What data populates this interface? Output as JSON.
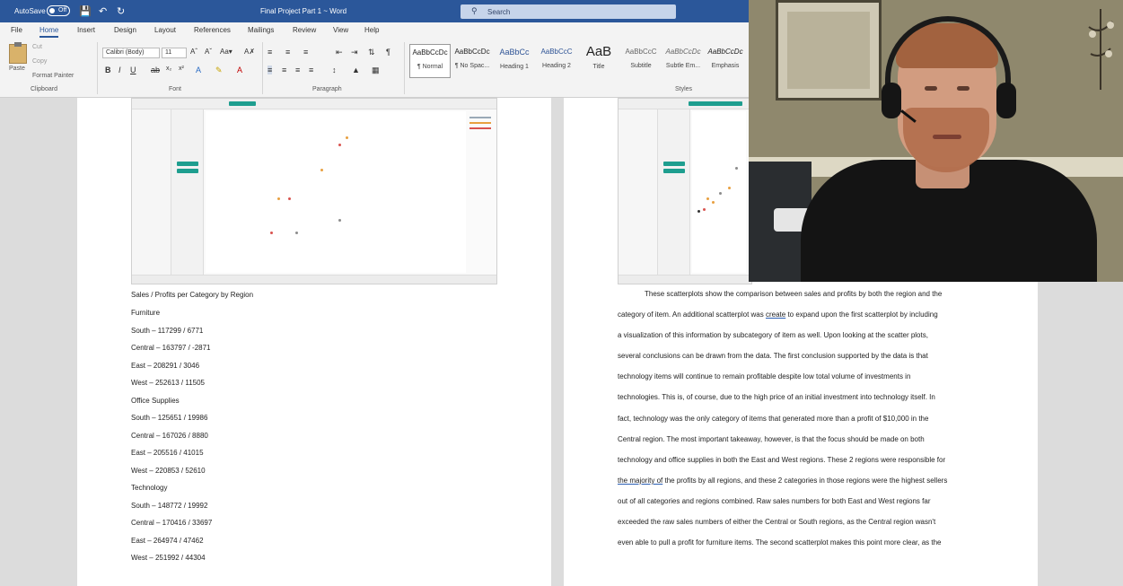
{
  "titlebar": {
    "autosave_label": "AutoSave",
    "autosave_state": "Off",
    "document_title": "Final Project Part 1 ~ Word",
    "search_placeholder": "Search"
  },
  "tabs": [
    "File",
    "Home",
    "Insert",
    "Design",
    "Layout",
    "References",
    "Mailings",
    "Review",
    "View",
    "Help"
  ],
  "active_tab": "Home",
  "ribbon": {
    "clipboard": {
      "paste": "Paste",
      "cut": "Cut",
      "copy": "Copy",
      "format_painter": "Format Painter",
      "label": "Clipboard"
    },
    "font": {
      "family": "Calibri (Body)",
      "size": "11",
      "label": "Font"
    },
    "paragraph_label": "Paragraph",
    "styles_label": "Styles",
    "styles": [
      {
        "sample": "AaBbCcDc",
        "name": "¶ Normal"
      },
      {
        "sample": "AaBbCcDc",
        "name": "¶ No Spac..."
      },
      {
        "sample": "AaBbCc",
        "name": "Heading 1"
      },
      {
        "sample": "AaBbCcC",
        "name": "Heading 2"
      },
      {
        "sample": "AaB",
        "name": "Title"
      },
      {
        "sample": "AaBbCcC",
        "name": "Subtitle"
      },
      {
        "sample": "AaBbCcDc",
        "name": "Subtle Em..."
      },
      {
        "sample": "AaBbCcDc",
        "name": "Emphasis"
      }
    ]
  },
  "left_page": {
    "heading": "Sales / Profits per Category by Region",
    "lines": [
      "Furniture",
      "South – 117299 / 6771",
      "Central – 163797 / -2871",
      "East – 208291 / 3046",
      "West – 252613 / 11505",
      "Office Supplies",
      "South – 125651 / 19986",
      "Central – 167026 / 8880",
      "East – 205516 / 41015",
      "West – 220853 / 52610",
      "Technology",
      "South – 148772 / 19992",
      "Central – 170416 / 33697",
      "East – 264974 / 47462",
      "West – 251992 / 44304"
    ]
  },
  "right_page": {
    "lines": [
      "These scatterplots show the comparison between sales and profits by both the region and the",
      "category of item.  An additional scatterplot was create to expand upon the first scatterplot by including",
      "a visualization of this information by subcategory of item as well.  Upon looking at the scatter plots,",
      "several conclusions can be drawn from the data.  The first conclusion supported by the data is that",
      "technology items will continue to remain profitable despite low total volume of investments in",
      "technologies.  This is, of course, due to the high price of an initial investment into technology itself.  In",
      "fact, technology was the only category of items that generated more than a profit of $10,000 in the",
      "Central region.  The most important takeaway, however, is that the focus should be made on both",
      "technology and office supplies in both the East and West regions.  These 2 regions were responsible for",
      "the majority of the profits by all regions, and these 2 categories in those regions were the highest sellers",
      "out of all categories and regions combined.  Raw sales numbers for both East and West regions far",
      "exceeded the raw sales numbers of either the Central or South regions, as the Central region wasn't",
      "even able to pull a profit for furniture items.  The second scatterplot makes this point more clear, as the"
    ]
  },
  "colors": {
    "word_blue": "#2b579a",
    "teal_pill": "#1e9e8f",
    "scatter_orange": "#e8a040",
    "scatter_red": "#d9534f",
    "scatter_gray": "#8c8c8c"
  }
}
